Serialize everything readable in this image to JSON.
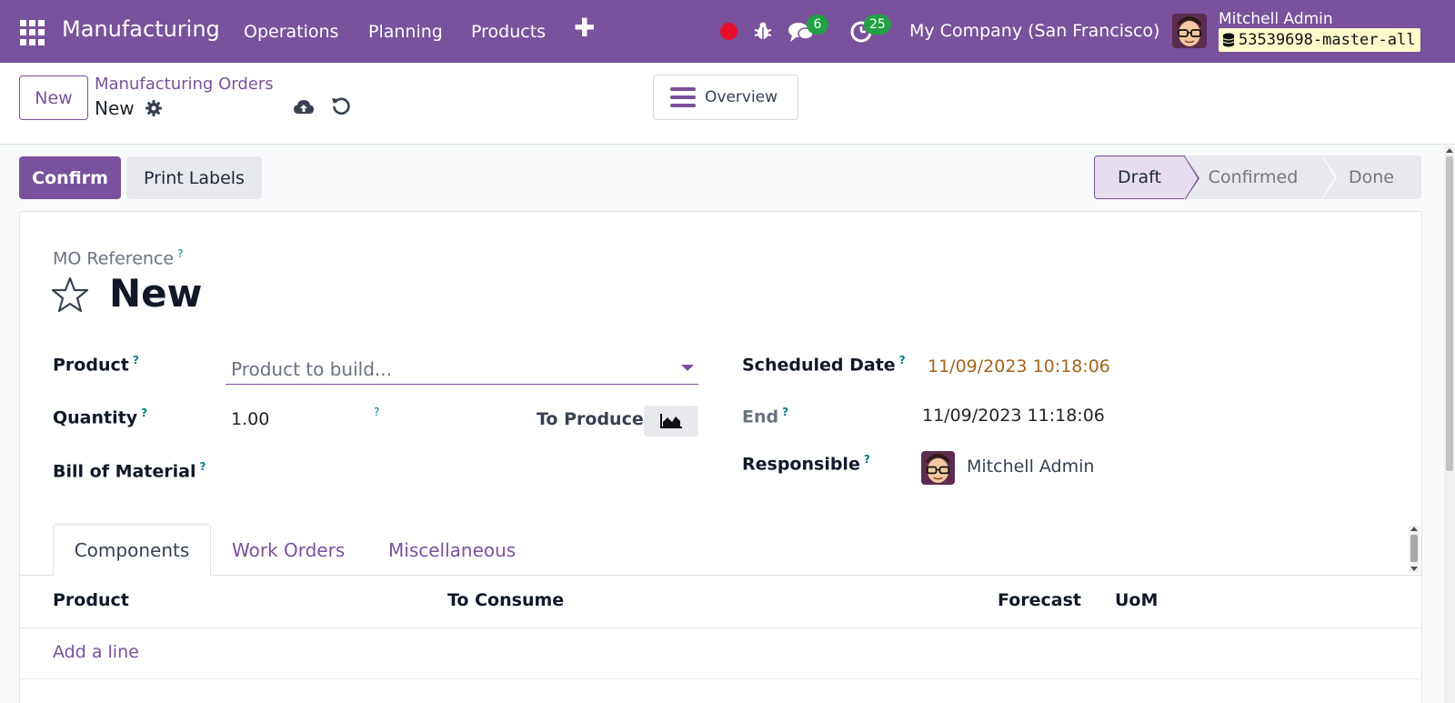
{
  "navbar": {
    "app_name": "Manufacturing",
    "menu": [
      "Operations",
      "Planning",
      "Products"
    ],
    "messages_count": "6",
    "activities_count": "25",
    "company": "My Company (San Francisco)",
    "user_name": "Mitchell Admin",
    "database": "53539698-master-all",
    "brand_color": "#7a519c"
  },
  "control_panel": {
    "new_label": "New",
    "breadcrumb_parent": "Manufacturing Orders",
    "breadcrumb_current": "New",
    "overview_label": "Overview"
  },
  "actions": {
    "confirm_label": "Confirm",
    "print_labels_label": "Print Labels"
  },
  "statusbar": {
    "stages": [
      "Draft",
      "Confirmed",
      "Done"
    ],
    "current": "Draft"
  },
  "form": {
    "mo_reference_label": "MO Reference",
    "help_mark": "?",
    "title": "New",
    "product_label": "Product",
    "product_placeholder": "Product to build...",
    "quantity_label": "Quantity",
    "quantity_value": "1.00",
    "to_produce_label": "To Produce",
    "bom_label": "Bill of Material",
    "scheduled_date_label": "Scheduled Date",
    "scheduled_date_value": "11/09/2023 10:18:06",
    "end_label": "End",
    "end_value": "11/09/2023 11:18:06",
    "responsible_label": "Responsible",
    "responsible_value": "Mitchell Admin"
  },
  "tabs": [
    "Components",
    "Work Orders",
    "Miscellaneous"
  ],
  "components_table": {
    "columns": [
      "Product",
      "To Consume",
      "Forecast",
      "UoM"
    ],
    "add_line_label": "Add a line"
  }
}
